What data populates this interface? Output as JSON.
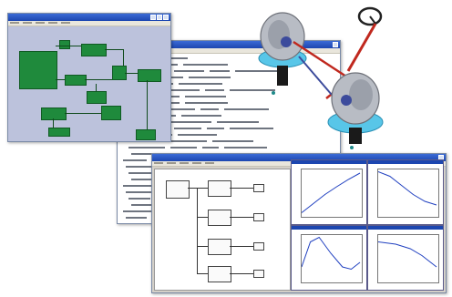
{
  "screenshot": {
    "description_free": true
  },
  "windows": {
    "block_diagram": {
      "title": ""
    },
    "equation_listing": {
      "title": ""
    },
    "simulation": {
      "title": ""
    }
  },
  "plots": [
    {
      "series": [
        [
          0,
          0.05
        ],
        [
          0.2,
          0.25
        ],
        [
          0.4,
          0.45
        ],
        [
          0.6,
          0.62
        ],
        [
          0.8,
          0.78
        ],
        [
          1,
          0.92
        ]
      ]
    },
    {
      "series": [
        [
          0,
          0.95
        ],
        [
          0.2,
          0.85
        ],
        [
          0.4,
          0.65
        ],
        [
          0.6,
          0.45
        ],
        [
          0.8,
          0.3
        ],
        [
          1,
          0.22
        ]
      ]
    },
    {
      "series": [
        [
          0,
          0.3
        ],
        [
          0.15,
          0.85
        ],
        [
          0.3,
          0.95
        ],
        [
          0.5,
          0.6
        ],
        [
          0.7,
          0.3
        ],
        [
          0.85,
          0.25
        ],
        [
          1,
          0.4
        ]
      ]
    },
    {
      "series": [
        [
          0,
          0.85
        ],
        [
          0.3,
          0.8
        ],
        [
          0.55,
          0.7
        ],
        [
          0.75,
          0.55
        ],
        [
          0.9,
          0.4
        ],
        [
          1,
          0.3
        ]
      ]
    }
  ],
  "colors": {
    "titlebar": "#1c46b0",
    "block_canvas": "#bcc2dc",
    "block": "#1f8a3c",
    "vehicle_body": "#b8bcc4",
    "vehicle_base": "#58c6e8",
    "link_red": "#c0281e"
  },
  "icons": {
    "steering_wheel": "steering-wheel-icon",
    "suspension_assembly": "suspension-assembly-icon"
  }
}
